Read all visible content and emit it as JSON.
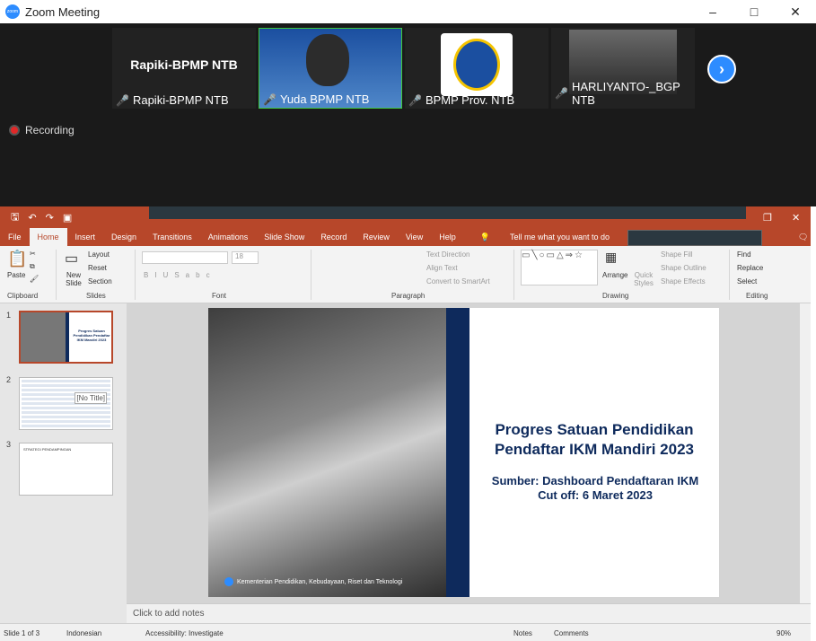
{
  "zoom": {
    "title": "Zoom Meeting",
    "logo_text": "zoom",
    "window_controls": [
      "–",
      "□",
      "✕"
    ],
    "participants": [
      {
        "display": "Rapiki-BPMP NTB",
        "name": "Rapiki-BPMP NTB",
        "muted": true
      },
      {
        "display": "",
        "name": "Yuda BPMP NTB",
        "muted": true
      },
      {
        "display": "",
        "name": "BPMP Prov. NTB",
        "muted": true
      },
      {
        "display": "",
        "name": "HARLIYANTO-_BGP NTB",
        "muted": true
      }
    ],
    "next_icon": "chevron-right-icon",
    "next_glyph": "›",
    "recording_label": "Recording"
  },
  "ppt": {
    "menu_tabs": [
      "File",
      "Home",
      "Insert",
      "Design",
      "Transitions",
      "Animations",
      "Slide Show",
      "Record",
      "Review",
      "View",
      "Help"
    ],
    "selected_tab": "Home",
    "tell_me": "Tell me what you want to do",
    "ribbon": {
      "clipboard_label": "Clipboard",
      "paste": "Paste",
      "slides_label": "Slides",
      "new_slide": "New Slide",
      "layout": "Layout",
      "reset": "Reset",
      "section": "Section",
      "font_label": "Font",
      "font_size": "18",
      "paragraph_label": "Paragraph",
      "text_direction": "Text Direction",
      "align_text": "Align Text",
      "convert_smartart": "Convert to SmartArt",
      "drawing_label": "Drawing",
      "arrange": "Arrange",
      "quick_styles": "Quick Styles",
      "shape_fill": "Shape Fill",
      "shape_outline": "Shape Outline",
      "shape_effects": "Shape Effects",
      "editing_label": "Editing",
      "find": "Find",
      "replace": "Replace",
      "select": "Select"
    },
    "thumbnails": [
      {
        "num": "1",
        "selected": true,
        "text": "Progres Satuan Pendidikan Pendaftar IKM Mandiri 2023"
      },
      {
        "num": "2",
        "selected": false,
        "text": "[No Title]"
      },
      {
        "num": "3",
        "selected": false,
        "text": "STRATEGI PENDAMPINGAN"
      }
    ],
    "slide": {
      "title": "Progres Satuan Pendidikan Pendaftar IKM Mandiri 2023",
      "subtitle_line1": "Sumber: Dashboard Pendaftaran IKM",
      "subtitle_line2": "Cut off: 6 Maret 2023",
      "footer": "Kementerian Pendidikan, Kebudayaan, Riset dan Teknologi"
    },
    "notes_placeholder": "Click to add notes",
    "status": {
      "slide_count": "Slide 1 of 3",
      "language": "Indonesian",
      "accessibility": "Accessibility: Investigate",
      "notes": "Notes",
      "comments": "Comments",
      "zoom": "90%"
    }
  }
}
